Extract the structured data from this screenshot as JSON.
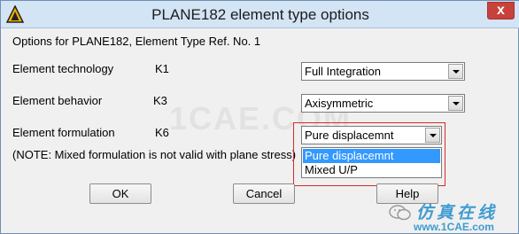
{
  "window": {
    "title": "PLANE182 element type options",
    "close_label": "x"
  },
  "header_text": "Options for PLANE182, Element Type Ref. No. 1",
  "options": [
    {
      "label": "Element technology",
      "key": "K1",
      "value": "Full Integration"
    },
    {
      "label": "Element behavior",
      "key": "K3",
      "value": "Axisymmetric"
    },
    {
      "label": "Element formulation",
      "key": "K6",
      "value": "Pure displacemnt"
    }
  ],
  "note": "(NOTE: Mixed formulation is not valid with plane stress)",
  "dropdown": {
    "items": [
      "Pure displacemnt",
      "Mixed U/P"
    ],
    "selected_index": 0
  },
  "buttons": {
    "ok": "OK",
    "cancel": "Cancel",
    "help": "Help"
  },
  "watermark": {
    "center": "1CAE.COM",
    "brand_cn": "仿真在线",
    "url": "www.1CAE.com"
  },
  "colors": {
    "highlight": "#3399ff",
    "annotation": "#d62a2a",
    "titlebar": "#d3e4f5"
  },
  "icons": {
    "app": "ansys-logo-icon",
    "close": "close-icon",
    "dropdown": "chevron-down-icon"
  }
}
